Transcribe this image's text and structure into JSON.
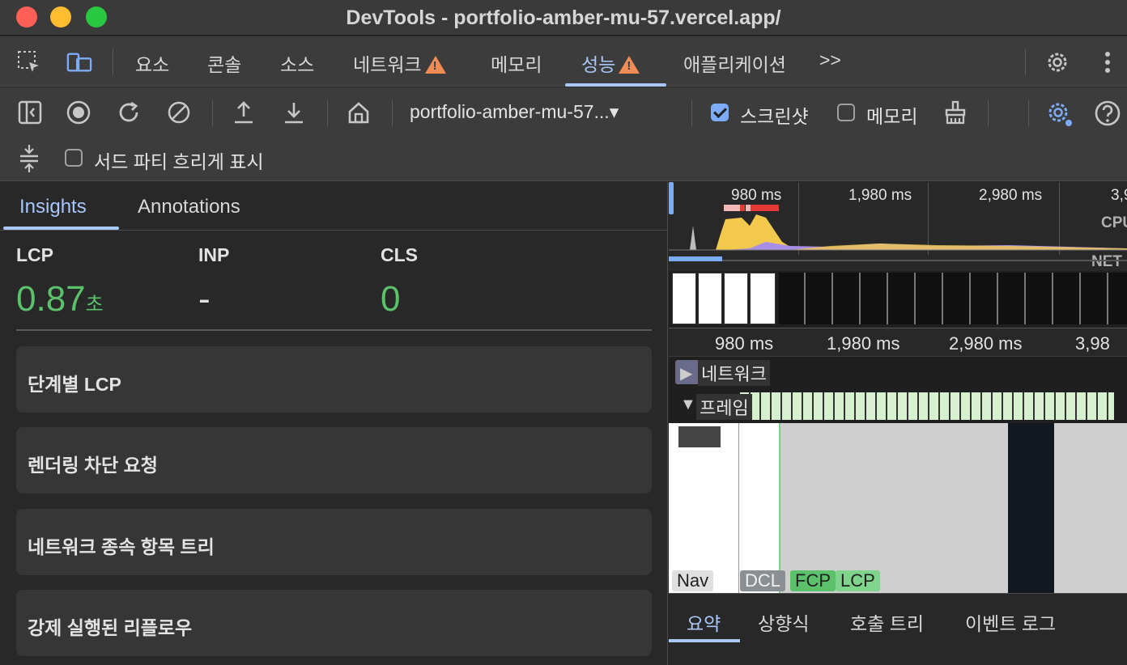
{
  "window": {
    "title": "DevTools - portfolio-amber-mu-57.vercel.app/"
  },
  "tabs": [
    {
      "label": "요소"
    },
    {
      "label": "콘솔"
    },
    {
      "label": "소스"
    },
    {
      "label": "네트워크",
      "warning": true
    },
    {
      "label": "메모리"
    },
    {
      "label": "성능",
      "warning": true,
      "active": true
    },
    {
      "label": "애플리케이션"
    }
  ],
  "tabs_more": ">>",
  "toolbar": {
    "url_select": "portfolio-amber-mu-57...▾",
    "screenshot_label": "스크린샷",
    "screenshot_checked": true,
    "memory_label": "메모리",
    "memory_checked": false,
    "third_party_label": "서드 파티 흐리게 표시",
    "third_party_checked": false
  },
  "sidebar": {
    "tabs": [
      {
        "label": "Insights",
        "active": true
      },
      {
        "label": "Annotations"
      }
    ],
    "metrics": [
      {
        "label": "LCP",
        "value": "0.87",
        "unit": "초"
      },
      {
        "label": "INP",
        "value": "-",
        "unit": ""
      },
      {
        "label": "CLS",
        "value": "0",
        "unit": ""
      }
    ],
    "insights": [
      {
        "label": "단계별 LCP"
      },
      {
        "label": "렌더링 차단 요청"
      },
      {
        "label": "네트워크 종속 항목 트리"
      },
      {
        "label": "강제 실행된 리플로우"
      }
    ]
  },
  "timeline": {
    "overview_ticks": [
      "980 ms",
      "1,980 ms",
      "2,980 ms",
      "3,9"
    ],
    "cpu_label": "CPU",
    "net_label": "NET",
    "main_ticks": [
      "980 ms",
      "1,980 ms",
      "2,980 ms",
      "3,98"
    ],
    "network_track": "네트워크",
    "frames_track": "프레임",
    "markers": [
      "Nav",
      "DCL",
      "FCP",
      "LCP"
    ]
  },
  "bottom_tabs": [
    {
      "label": "요약",
      "active": true
    },
    {
      "label": "상향식"
    },
    {
      "label": "호출 트리"
    },
    {
      "label": "이벤트 로그"
    }
  ],
  "colors": {
    "accent": "#a8c7fa",
    "good": "#5bc26b",
    "warning": "#f28b54"
  }
}
